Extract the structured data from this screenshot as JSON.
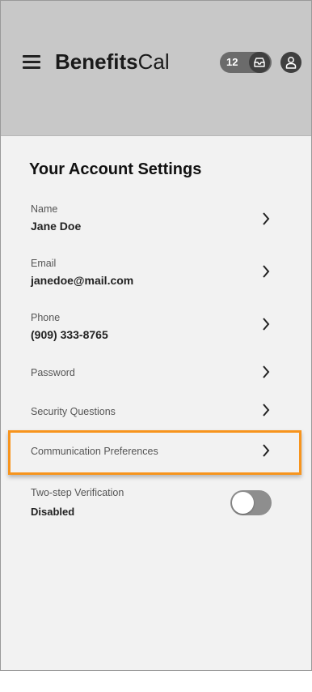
{
  "header": {
    "brand_bold": "Benefits",
    "brand_light": "Cal",
    "notification_count": "12",
    "icons": {
      "menu": "hamburger-menu-icon",
      "inbox": "inbox-icon",
      "profile": "user-icon"
    }
  },
  "settings": {
    "title": "Your Account Settings",
    "items": [
      {
        "label": "Name",
        "value": "Jane Doe"
      },
      {
        "label": "Email",
        "value": "janedoe@mail.com"
      },
      {
        "label": "Phone",
        "value": "(909) 333-8765"
      },
      {
        "label": "Password"
      },
      {
        "label": "Security Questions"
      },
      {
        "label": "Communication Preferences",
        "highlighted": true
      },
      {
        "label": "Two-step Verification",
        "value": "Disabled",
        "toggle_on": false
      }
    ]
  },
  "colors": {
    "header_bg": "#c8c8c8",
    "page_bg": "#f2f2f2",
    "highlight": "#f7941d",
    "toggle_off": "#8e8e8e"
  }
}
